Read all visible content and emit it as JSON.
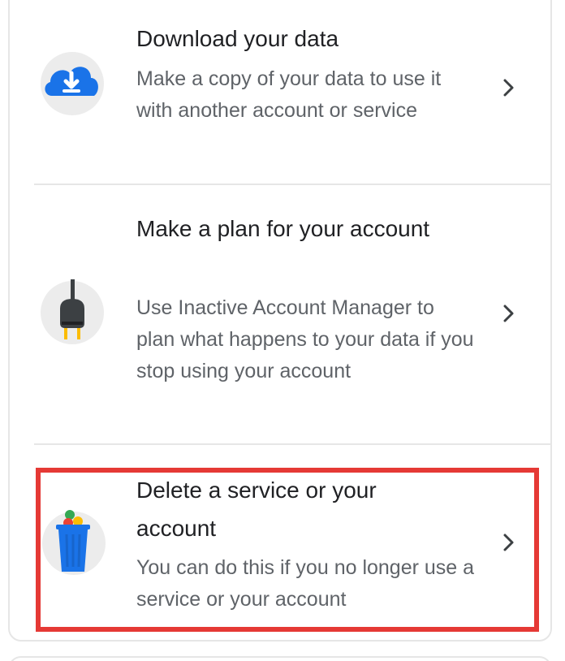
{
  "items": [
    {
      "title": "Download your data",
      "description": "Make a copy of your data to use it with another account or service",
      "icon": "cloud-download-icon"
    },
    {
      "title": "Make a plan for your account",
      "description": "Use Inactive Account Manager to plan what happens to your data if you stop using your account",
      "icon": "plug-icon"
    },
    {
      "title": "Delete a service or your account",
      "description": "You can do this if you no longer use a service or your account",
      "icon": "trash-can-icon"
    }
  ],
  "colors": {
    "highlight": "#e53935",
    "cloud": "#1a73e8",
    "trash": "#1a73e8",
    "plug": "#3c4043",
    "prongs": "#fbbc04"
  }
}
